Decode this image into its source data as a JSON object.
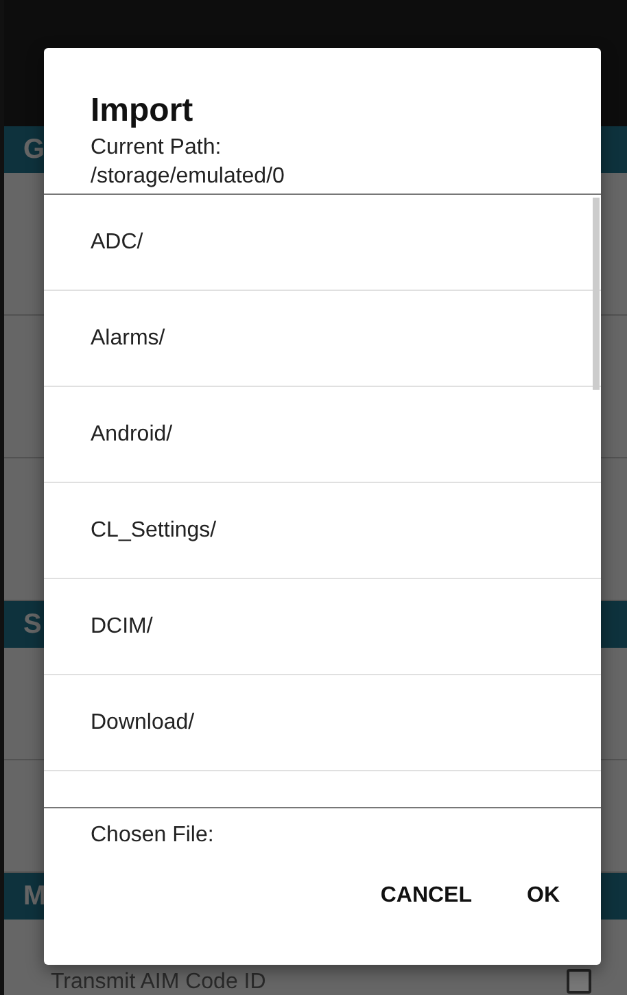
{
  "background": {
    "sections": [
      {
        "header": "G"
      },
      {
        "header": "S"
      },
      {
        "header": "M"
      }
    ],
    "last_row": {
      "label": "Transmit AIM Code ID",
      "checked": false
    }
  },
  "dialog": {
    "title": "Import",
    "path_label": "Current Path:",
    "path": "/storage/emulated/0",
    "items": [
      {
        "name": "ADC/"
      },
      {
        "name": "Alarms/"
      },
      {
        "name": "Android/"
      },
      {
        "name": "CL_Settings/"
      },
      {
        "name": "DCIM/"
      },
      {
        "name": "Download/"
      }
    ],
    "chosen_label": "Chosen File:",
    "buttons": [
      {
        "label": "CANCEL"
      },
      {
        "label": "OK"
      }
    ]
  }
}
